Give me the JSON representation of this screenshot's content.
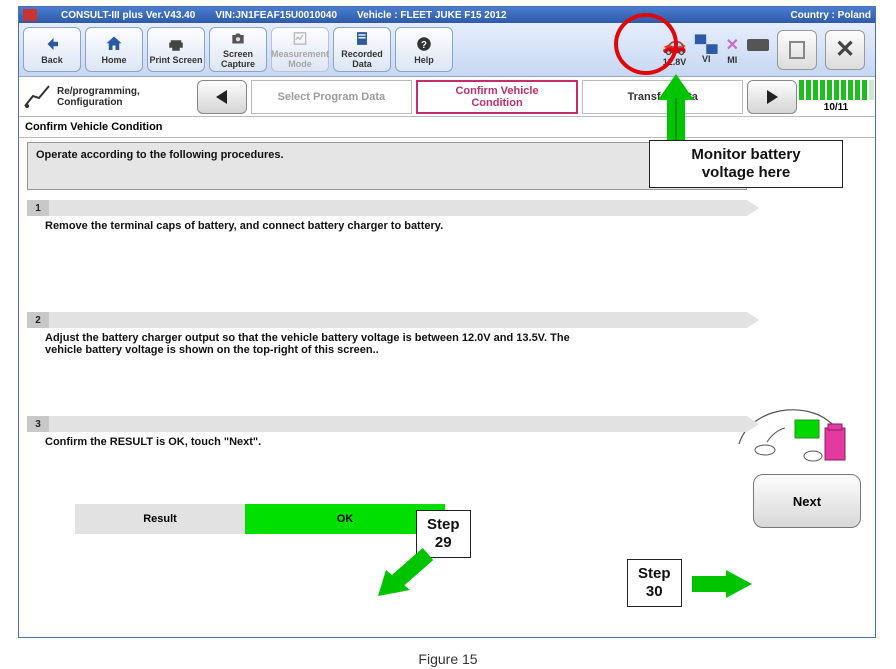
{
  "titlebar": {
    "t1": "CONSULT-III plus  Ver.V43.40",
    "t2": "VIN:JN1FEAF15U0010040",
    "t3": "Vehicle : FLEET JUKE F15 2012",
    "t4": "Country : Poland"
  },
  "toolbar": {
    "back": "Back",
    "home": "Home",
    "print": "Print Screen",
    "capture": "Screen\nCapture",
    "measure": "Measurement\nMode",
    "recorded": "Recorded\nData",
    "help": "Help"
  },
  "status": {
    "battery_voltage": "12.8V",
    "vi": "VI",
    "mi": "MI"
  },
  "breadcrumb": {
    "root": "Re/programming,\nConfiguration",
    "step_prev": "Select Program Data",
    "step_active": "Confirm Vehicle\nCondition",
    "step_next": "Transfer Data",
    "progress": "10/11"
  },
  "section_title": "Confirm Vehicle Condition",
  "instr": "Operate according to the following procedures.",
  "steps": {
    "s1_num": "1",
    "s1_text": "Remove the terminal caps of battery, and connect battery charger to battery.",
    "s2_num": "2",
    "s2_text": "Adjust the battery charger output so that the vehicle battery voltage is between 12.0V and 13.5V. The vehicle battery voltage is shown on the top-right of this screen..",
    "s3_num": "3",
    "s3_text": "Confirm the RESULT is OK, touch \"Next\"."
  },
  "result": {
    "label": "Result",
    "value": "OK"
  },
  "next_label": "Next",
  "annotations": {
    "monitor": "Monitor battery\nvoltage here",
    "step29": "Step\n29",
    "step30": "Step\n30"
  },
  "figure": "Figure 15"
}
